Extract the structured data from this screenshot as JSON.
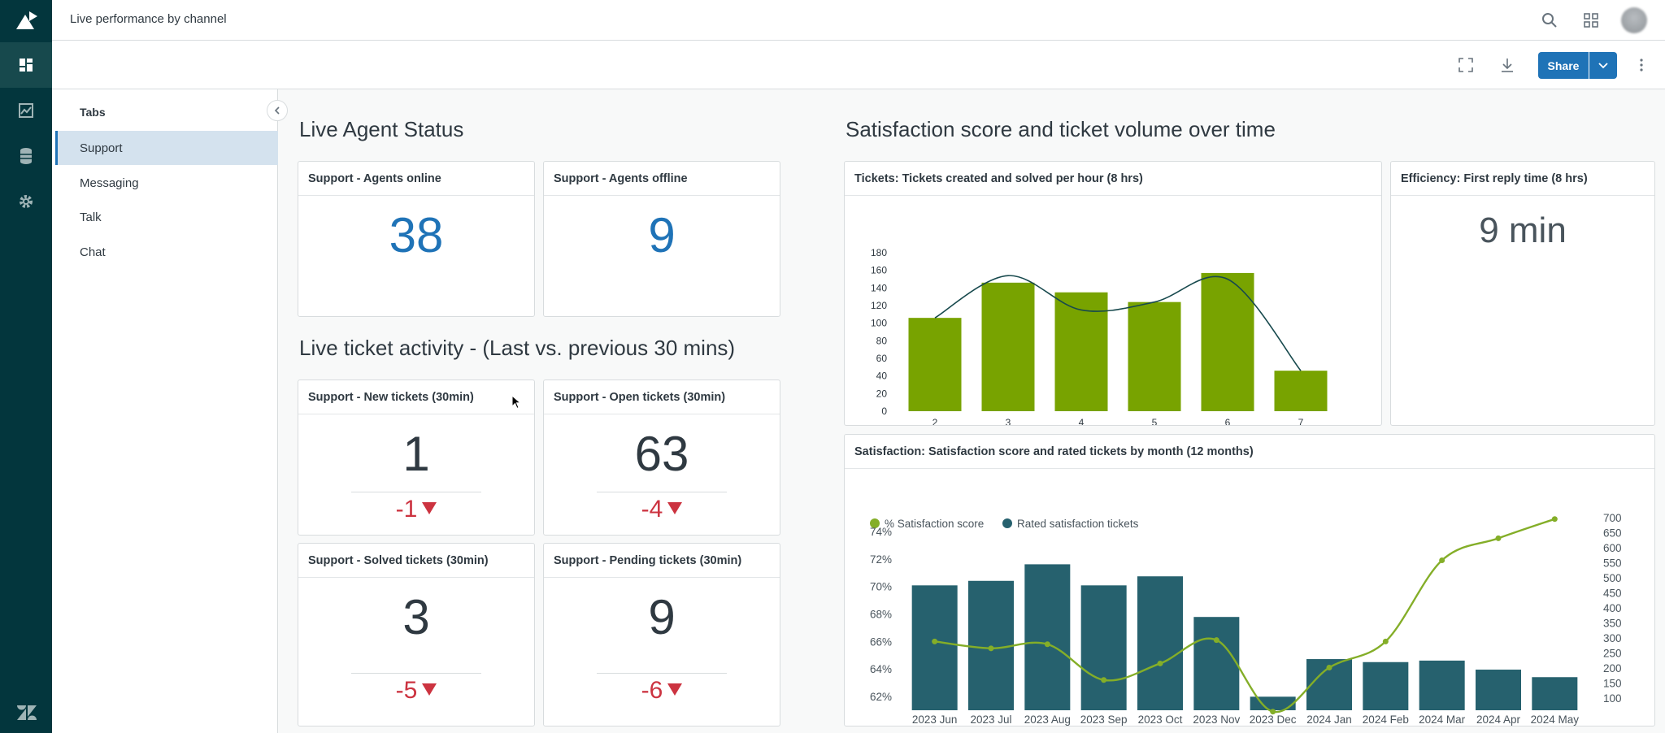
{
  "topbar": {
    "title": "Live performance by channel"
  },
  "toolbar": {
    "share_label": "Share"
  },
  "sidebar": {
    "heading": "Tabs",
    "items": [
      {
        "label": "Support",
        "active": true
      },
      {
        "label": "Messaging"
      },
      {
        "label": "Talk"
      },
      {
        "label": "Chat"
      }
    ]
  },
  "sections": {
    "agent_status": "Live Agent Status",
    "ticket_activity": "Live ticket activity - (Last vs. previous 30 mins)",
    "satisfaction": "Satisfaction score and ticket volume over time"
  },
  "cards": {
    "agents_online": {
      "title": "Support - Agents online",
      "value": "38"
    },
    "agents_offline": {
      "title": "Support - Agents offline",
      "value": "9"
    },
    "new_tickets": {
      "title": "Support - New tickets (30min)",
      "value": "1",
      "delta": "-1"
    },
    "open_tickets": {
      "title": "Support - Open tickets (30min)",
      "value": "63",
      "delta": "-4"
    },
    "solved_tickets": {
      "title": "Support - Solved tickets (30min)",
      "value": "3",
      "delta": "-5"
    },
    "pending_tickets": {
      "title": "Support - Pending tickets (30min)",
      "value": "9",
      "delta": "-6"
    },
    "tickets_chart": {
      "title": "Tickets: Tickets created and solved per hour (8 hrs)"
    },
    "first_reply": {
      "title": "Efficiency: First reply time (8 hrs)",
      "value": "9 min"
    },
    "satisfaction_chart": {
      "title": "Satisfaction: Satisfaction score and rated tickets by month (12 months)"
    }
  },
  "colors": {
    "accent": "#1f73b7",
    "rail": "#03363d",
    "bar_green": "#78a300",
    "bar_teal": "#26616e",
    "line_green": "#84ae28",
    "negative": "#cc3340"
  },
  "chart_data": [
    {
      "type": "bar",
      "title": "Tickets: Tickets created and solved per hour (8 hrs)",
      "categories": [
        "2",
        "3",
        "4",
        "5",
        "6",
        "7"
      ],
      "ylim": [
        0,
        180
      ],
      "yticks": [
        0,
        20,
        40,
        60,
        80,
        100,
        120,
        140,
        160,
        180
      ],
      "grid": false,
      "series": [
        {
          "type": "bar",
          "values": [
            106,
            146,
            135,
            124,
            157,
            46
          ]
        },
        {
          "type": "line",
          "values": [
            106,
            154,
            115,
            124,
            150,
            46
          ]
        }
      ]
    },
    {
      "type": "bar",
      "title": "Satisfaction: Satisfaction score and rated tickets by month (12 months)",
      "categories": [
        "2023 Jun",
        "2023 Jul",
        "2023 Aug",
        "2023 Sep",
        "2023 Oct",
        "2023 Nov",
        "2023 Dec",
        "2024 Jan",
        "2024 Feb",
        "2024 Mar",
        "2024 Apr",
        "2024 May"
      ],
      "legend_position": "top-left",
      "left_axis": {
        "ylim": [
          61,
          75
        ],
        "ticks": [
          "62%",
          "64%",
          "66%",
          "68%",
          "70%",
          "72%",
          "74%"
        ]
      },
      "right_axis": {
        "ylim": [
          60,
          700
        ],
        "ticks": [
          "100",
          "150",
          "200",
          "250",
          "300",
          "350",
          "400",
          "450",
          "500",
          "550",
          "600",
          "650",
          "700"
        ]
      },
      "series": [
        {
          "name": "Rated satisfaction tickets",
          "type": "bar",
          "axis": "right",
          "values": [
            475,
            490,
            545,
            475,
            505,
            370,
            105,
            230,
            220,
            225,
            195,
            170
          ]
        },
        {
          "name": "% Satisfaction score",
          "type": "line",
          "axis": "left",
          "values": [
            66.0,
            65.5,
            65.8,
            63.2,
            64.4,
            66.1,
            60.9,
            64.1,
            66.0,
            71.9,
            73.5,
            74.9
          ]
        }
      ]
    }
  ]
}
